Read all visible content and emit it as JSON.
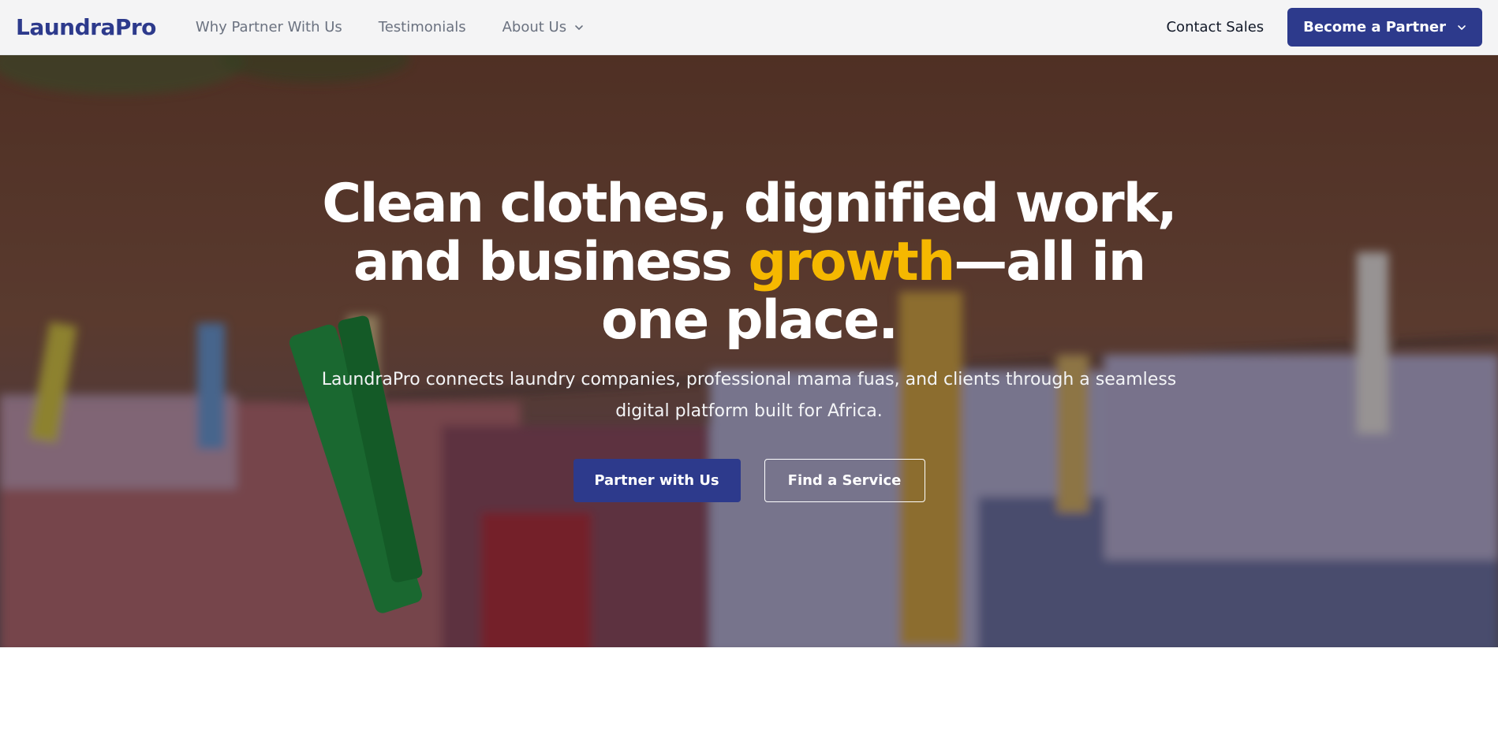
{
  "nav": {
    "logo": "LaundraPro",
    "links": [
      {
        "label": "Why Partner With Us"
      },
      {
        "label": "Testimonials"
      },
      {
        "label": "About Us"
      }
    ],
    "contact_sales": "Contact Sales",
    "become_partner": "Become a Partner"
  },
  "hero": {
    "title_part1": "Clean clothes, dignified work, and business ",
    "title_highlight": "growth",
    "title_part2": "—all in one place.",
    "subtitle": "LaundraPro connects laundry companies, professional mama fuas, and clients through a seamless digital platform built for Africa.",
    "primary_button": "Partner with Us",
    "secondary_button": "Find a Service"
  },
  "colors": {
    "brand": "#2d3a8c",
    "highlight": "#f5b800",
    "nav_bg": "#f4f4f5"
  },
  "icons": {
    "about_dropdown": "chevron-down-icon",
    "partner_dropdown": "chevron-down-icon"
  }
}
